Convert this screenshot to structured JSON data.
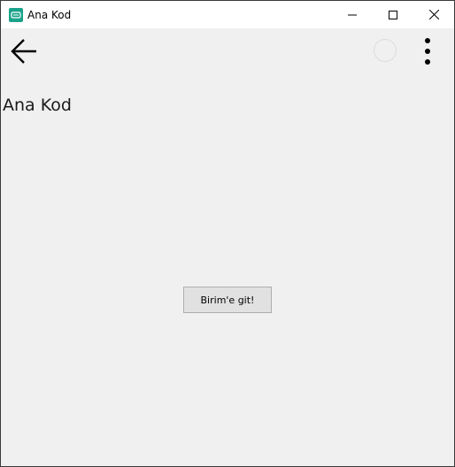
{
  "window": {
    "title": "Ana Kod",
    "app_icon": "app-icon",
    "controls": {
      "minimize_icon": "minimize-icon",
      "maximize_icon": "maximize-icon",
      "close_icon": "close-icon"
    }
  },
  "toolbar": {
    "back_icon": "arrow-left-icon",
    "activity_icon": "activity-indicator",
    "more_icon": "more-vertical-icon"
  },
  "page": {
    "title": "Ana Kod",
    "button_label": "Birim'e git!"
  },
  "colors": {
    "background": "#f0f0f0",
    "titlebar": "#ffffff",
    "app_icon": "#1aa38a",
    "button_bg": "#e1e1e1",
    "button_border": "#adadad"
  }
}
